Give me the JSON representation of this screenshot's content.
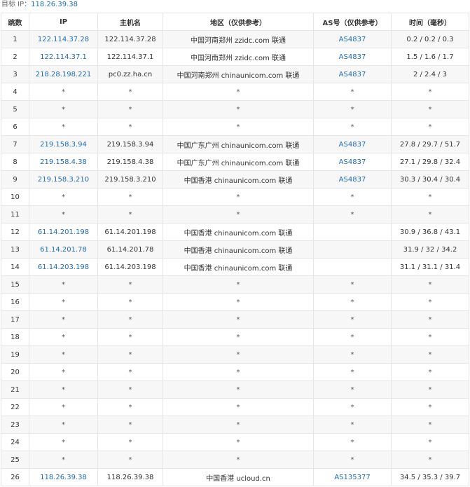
{
  "target": {
    "label": "目标 IP：",
    "ip": "118.26.39.38"
  },
  "columns": [
    "跳数",
    "IP",
    "主机名",
    "地区（仅供参考）",
    "AS号（仅供参考）",
    "时间（毫秒）"
  ],
  "rows": [
    {
      "hop": "1",
      "ip": "122.114.37.28",
      "host": "122.114.37.28",
      "region": "中国河南郑州 zzidc.com 联通",
      "as": "AS4837",
      "time": "0.2 / 0.2 / 0.3"
    },
    {
      "hop": "2",
      "ip": "122.114.37.1",
      "host": "122.114.37.1",
      "region": "中国河南郑州 zzidc.com 联通",
      "as": "AS4837",
      "time": "1.5 / 1.6 / 1.7"
    },
    {
      "hop": "3",
      "ip": "218.28.198.221",
      "host": "pc0.zz.ha.cn",
      "region": "中国河南郑州 chinaunicom.com 联通",
      "as": "AS4837",
      "time": "2 / 2.4 / 3"
    },
    {
      "hop": "4",
      "ip": "*",
      "host": "*",
      "region": "*",
      "as": "*",
      "time": "*"
    },
    {
      "hop": "5",
      "ip": "*",
      "host": "*",
      "region": "*",
      "as": "*",
      "time": "*"
    },
    {
      "hop": "6",
      "ip": "*",
      "host": "*",
      "region": "*",
      "as": "*",
      "time": "*"
    },
    {
      "hop": "7",
      "ip": "219.158.3.94",
      "host": "219.158.3.94",
      "region": "中国广东广州 chinaunicom.com 联通",
      "as": "AS4837",
      "time": "27.8 / 29.7 / 51.7"
    },
    {
      "hop": "8",
      "ip": "219.158.4.38",
      "host": "219.158.4.38",
      "region": "中国广东广州 chinaunicom.com 联通",
      "as": "AS4837",
      "time": "27.1 / 29.8 / 32.4"
    },
    {
      "hop": "9",
      "ip": "219.158.3.210",
      "host": "219.158.3.210",
      "region": "中国香港 chinaunicom.com 联通",
      "as": "AS4837",
      "time": "30.3 / 30.4 / 30.4"
    },
    {
      "hop": "10",
      "ip": "*",
      "host": "*",
      "region": "*",
      "as": "*",
      "time": "*"
    },
    {
      "hop": "11",
      "ip": "*",
      "host": "*",
      "region": "*",
      "as": "*",
      "time": "*"
    },
    {
      "hop": "12",
      "ip": "61.14.201.198",
      "host": "61.14.201.198",
      "region": "中国香港 chinaunicom.com 联通",
      "as": "",
      "time": "30.9 / 36.8 / 43.1"
    },
    {
      "hop": "13",
      "ip": "61.14.201.78",
      "host": "61.14.201.78",
      "region": "中国香港 chinaunicom.com 联通",
      "as": "",
      "time": "31.9 / 32 / 34.2"
    },
    {
      "hop": "14",
      "ip": "61.14.203.198",
      "host": "61.14.203.198",
      "region": "中国香港 chinaunicom.com 联通",
      "as": "",
      "time": "31.1 / 31.1 / 31.4"
    },
    {
      "hop": "15",
      "ip": "*",
      "host": "*",
      "region": "*",
      "as": "*",
      "time": "*"
    },
    {
      "hop": "16",
      "ip": "*",
      "host": "*",
      "region": "*",
      "as": "*",
      "time": "*"
    },
    {
      "hop": "17",
      "ip": "*",
      "host": "*",
      "region": "*",
      "as": "*",
      "time": "*"
    },
    {
      "hop": "18",
      "ip": "*",
      "host": "*",
      "region": "*",
      "as": "*",
      "time": "*"
    },
    {
      "hop": "19",
      "ip": "*",
      "host": "*",
      "region": "*",
      "as": "*",
      "time": "*"
    },
    {
      "hop": "20",
      "ip": "*",
      "host": "*",
      "region": "*",
      "as": "*",
      "time": "*"
    },
    {
      "hop": "21",
      "ip": "*",
      "host": "*",
      "region": "*",
      "as": "*",
      "time": "*"
    },
    {
      "hop": "22",
      "ip": "*",
      "host": "*",
      "region": "*",
      "as": "*",
      "time": "*"
    },
    {
      "hop": "23",
      "ip": "*",
      "host": "*",
      "region": "*",
      "as": "*",
      "time": "*"
    },
    {
      "hop": "24",
      "ip": "*",
      "host": "*",
      "region": "*",
      "as": "*",
      "time": "*"
    },
    {
      "hop": "25",
      "ip": "*",
      "host": "*",
      "region": "*",
      "as": "*",
      "time": "*"
    },
    {
      "hop": "26",
      "ip": "118.26.39.38",
      "host": "118.26.39.38",
      "region": "中国香港 ucloud.cn",
      "as": "AS135377",
      "time": "34.5 / 35.3 / 39.7"
    }
  ],
  "colors": {
    "link": "#1e6bb8",
    "stripe": "#f7f7f7",
    "border": "#e6e6e6"
  }
}
